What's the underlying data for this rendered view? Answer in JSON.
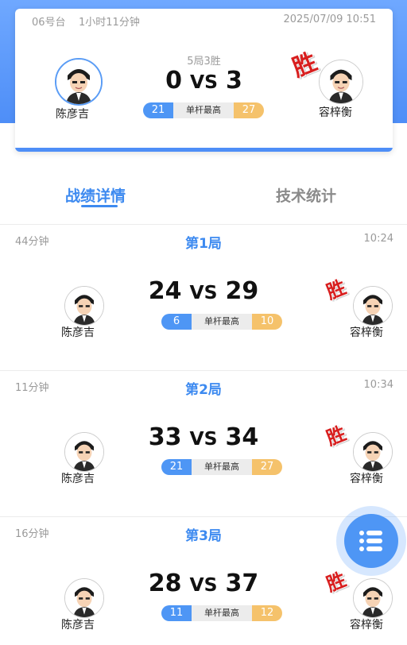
{
  "header": {
    "table": "06号台",
    "duration": "1小时11分钟",
    "datetime": "2025/07/09 10:51",
    "format": "5局3胜",
    "left_player": "陈彦吉",
    "right_player": "容梓衡",
    "left_score": "0",
    "vs": "VS",
    "right_score": "3",
    "left_high": "21",
    "high_label": "单杆最高",
    "right_high": "27",
    "winner_mark": "胜"
  },
  "tabs": [
    {
      "label": "战绩详情",
      "active": true
    },
    {
      "label": "技术统计",
      "active": false
    }
  ],
  "games": [
    {
      "duration": "44分钟",
      "title": "第1局",
      "time": "10:24",
      "left_player": "陈彦吉",
      "right_player": "容梓衡",
      "left_score": "24",
      "vs": "VS",
      "right_score": "29",
      "left_high": "6",
      "high_label": "单杆最高",
      "right_high": "10",
      "winner_mark": "胜"
    },
    {
      "duration": "11分钟",
      "title": "第2局",
      "time": "10:34",
      "left_player": "陈彦吉",
      "right_player": "容梓衡",
      "left_score": "33",
      "vs": "VS",
      "right_score": "34",
      "left_high": "21",
      "high_label": "单杆最高",
      "right_high": "27",
      "winner_mark": "胜"
    },
    {
      "duration": "16分钟",
      "title": "第3局",
      "time": "",
      "left_player": "陈彦吉",
      "right_player": "容梓衡",
      "left_score": "28",
      "vs": "VS",
      "right_score": "37",
      "left_high": "11",
      "high_label": "单杆最高",
      "right_high": "12",
      "winner_mark": "胜"
    }
  ],
  "fab": {
    "icon": "list-icon"
  },
  "colors": {
    "accent": "#3d8af0",
    "header_bg": "#4e8ef7",
    "left_pill": "#4e96f5",
    "right_pill": "#f5c26b",
    "win_mark": "#d81e1e"
  }
}
